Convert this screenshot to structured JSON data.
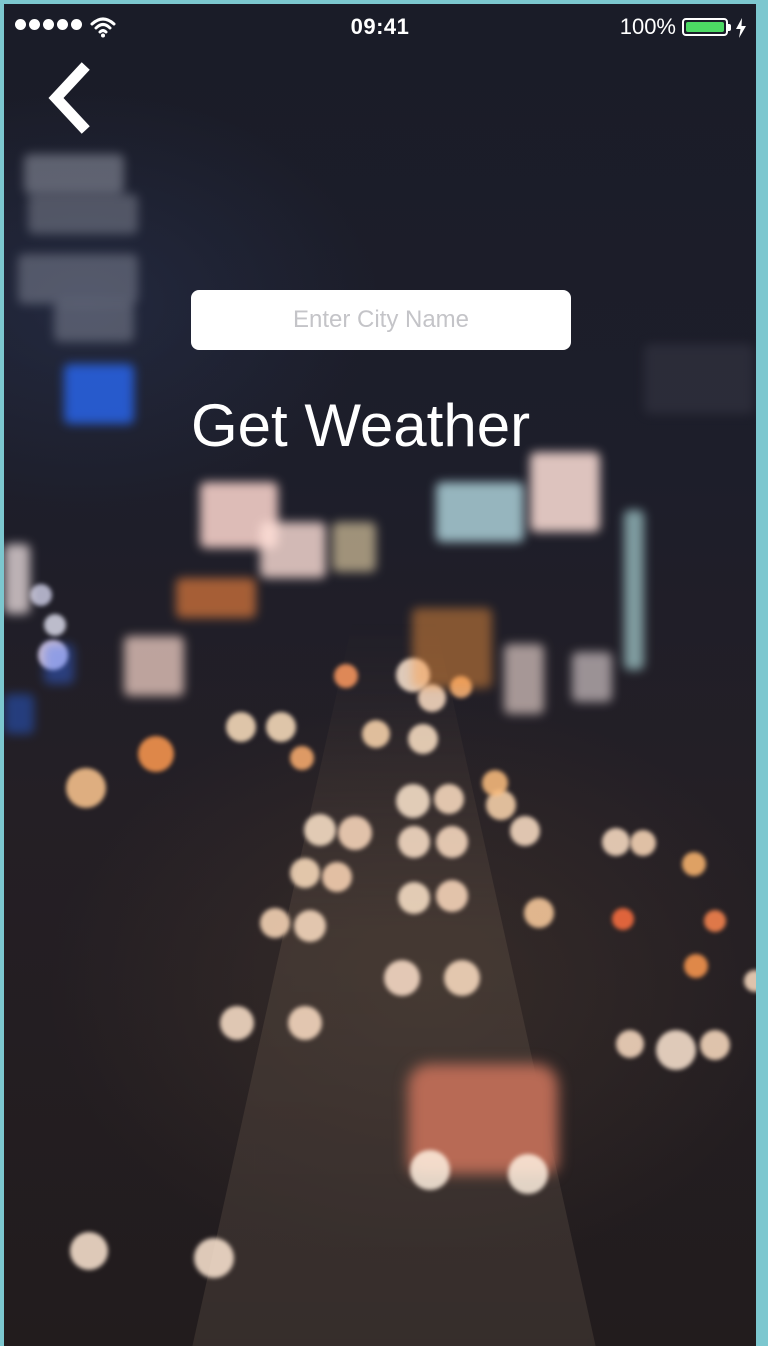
{
  "status_bar": {
    "time": "09:41",
    "battery_percent": "100%",
    "signal_bars": 5,
    "battery_level": 1.0,
    "battery_color": "#4cd964",
    "icons": [
      "signal-dots-icon",
      "wifi-icon",
      "battery-icon",
      "charging-bolt-icon"
    ]
  },
  "nav": {
    "back_icon": "chevron-left-icon"
  },
  "form": {
    "city_input_value": "",
    "city_input_placeholder": "Enter City Name",
    "get_weather_label": "Get Weather"
  },
  "background": {
    "description_icon": "blurred-night-city-traffic-image"
  }
}
